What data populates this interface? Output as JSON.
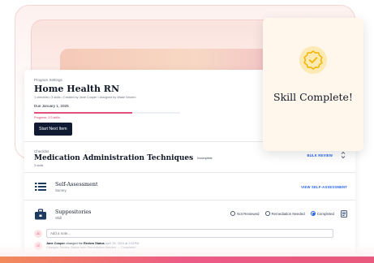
{
  "program": {
    "eyebrow": "Program Settings",
    "title": "Home Health RN",
    "meta": "1 checklist  •  3 skills  •  Created by Jane Cooper  •  Assigned by Wade Warren",
    "due_date": "Due January 1, 2025",
    "progress_fraction": 0.67,
    "progress_label": "Progress: 2/3 skills",
    "start_button": "Start Next Item"
  },
  "checklist": {
    "eyebrow": "Checklist",
    "title": "Medication Administration Techniques",
    "status": "Incomplete",
    "meta": "3 skills",
    "bulk_review": "BULK REVIEW"
  },
  "items": [
    {
      "title": "Self-Assessment",
      "subtitle": "Survey",
      "action": "VIEW SELF-ASSESSMENT",
      "icon": "list-icon"
    },
    {
      "title": "Suppositories",
      "subtitle": "Skill",
      "icon": "briefcase-icon",
      "options": [
        "Not Reviewed",
        "Remediation Needed",
        "Completed"
      ],
      "selected": "Completed"
    }
  ],
  "note": {
    "avatar_initials": "JC",
    "placeholder": "Add a note..."
  },
  "activity": {
    "avatar_initials": "JC",
    "actor": "Jane Cooper",
    "verb": "changed the",
    "field": "Review Status",
    "time": "April 26, 2024 at 2:51PM",
    "detail": "Changed Review Status from Remediation Needed → Completed"
  },
  "skill_card": {
    "text": "Skill Complete!",
    "accent_color": "#f2b705",
    "icon": "medal-check-icon"
  },
  "colors": {
    "brand_pink": "#e0507a",
    "navy": "#111a33",
    "link_blue": "#2563eb"
  }
}
